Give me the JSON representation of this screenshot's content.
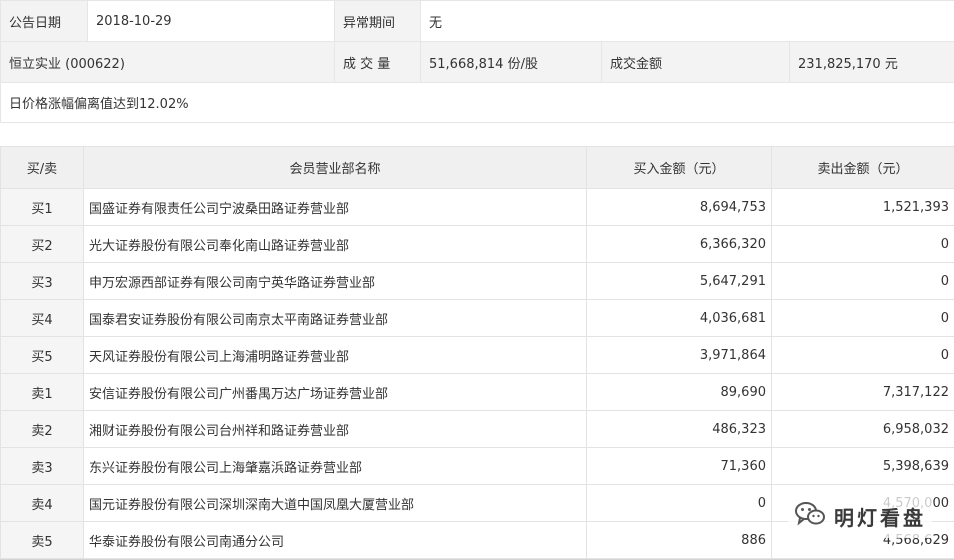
{
  "info": {
    "date_label": "公告日期",
    "date_value": "2018-10-29",
    "period_label": "异常期间",
    "period_value": "无",
    "stock": "恒立实业 (000622)",
    "volume_label": "成 交 量",
    "volume_value": "51,668,814 份/股",
    "amount_label": "成交金额",
    "amount_value": "231,825,170 元",
    "note": "日价格涨幅偏离值达到12.02%"
  },
  "table": {
    "headers": [
      "买/卖",
      "会员营业部名称",
      "买入金额（元）",
      "卖出金额（元）"
    ],
    "rows": [
      {
        "side": "买1",
        "name": "国盛证券有限责任公司宁波桑田路证券营业部",
        "buy": "8,694,753",
        "sell": "1,521,393"
      },
      {
        "side": "买2",
        "name": "光大证券股份有限公司奉化南山路证券营业部",
        "buy": "6,366,320",
        "sell": "0"
      },
      {
        "side": "买3",
        "name": "申万宏源西部证券有限公司南宁英华路证券营业部",
        "buy": "5,647,291",
        "sell": "0"
      },
      {
        "side": "买4",
        "name": "国泰君安证券股份有限公司南京太平南路证券营业部",
        "buy": "4,036,681",
        "sell": "0"
      },
      {
        "side": "买5",
        "name": "天风证券股份有限公司上海浦明路证券营业部",
        "buy": "3,971,864",
        "sell": "0"
      },
      {
        "side": "卖1",
        "name": "安信证券股份有限公司广州番禺万达广场证券营业部",
        "buy": "89,690",
        "sell": "7,317,122"
      },
      {
        "side": "卖2",
        "name": "湘财证券股份有限公司台州祥和路证券营业部",
        "buy": "486,323",
        "sell": "6,958,032"
      },
      {
        "side": "卖3",
        "name": "东兴证券股份有限公司上海肇嘉浜路证券营业部",
        "buy": "71,360",
        "sell": "5,398,639"
      },
      {
        "side": "卖4",
        "name": "国元证券股份有限公司深圳深南大道中国凤凰大厦营业部",
        "buy": "0",
        "sell": "4,570,000"
      },
      {
        "side": "卖5",
        "name": "华泰证券股份有限公司南通分公司",
        "buy": "886",
        "sell": "4,568,629"
      }
    ]
  },
  "watermark": {
    "text": "明灯看盘",
    "icon": "wechat-icon"
  }
}
